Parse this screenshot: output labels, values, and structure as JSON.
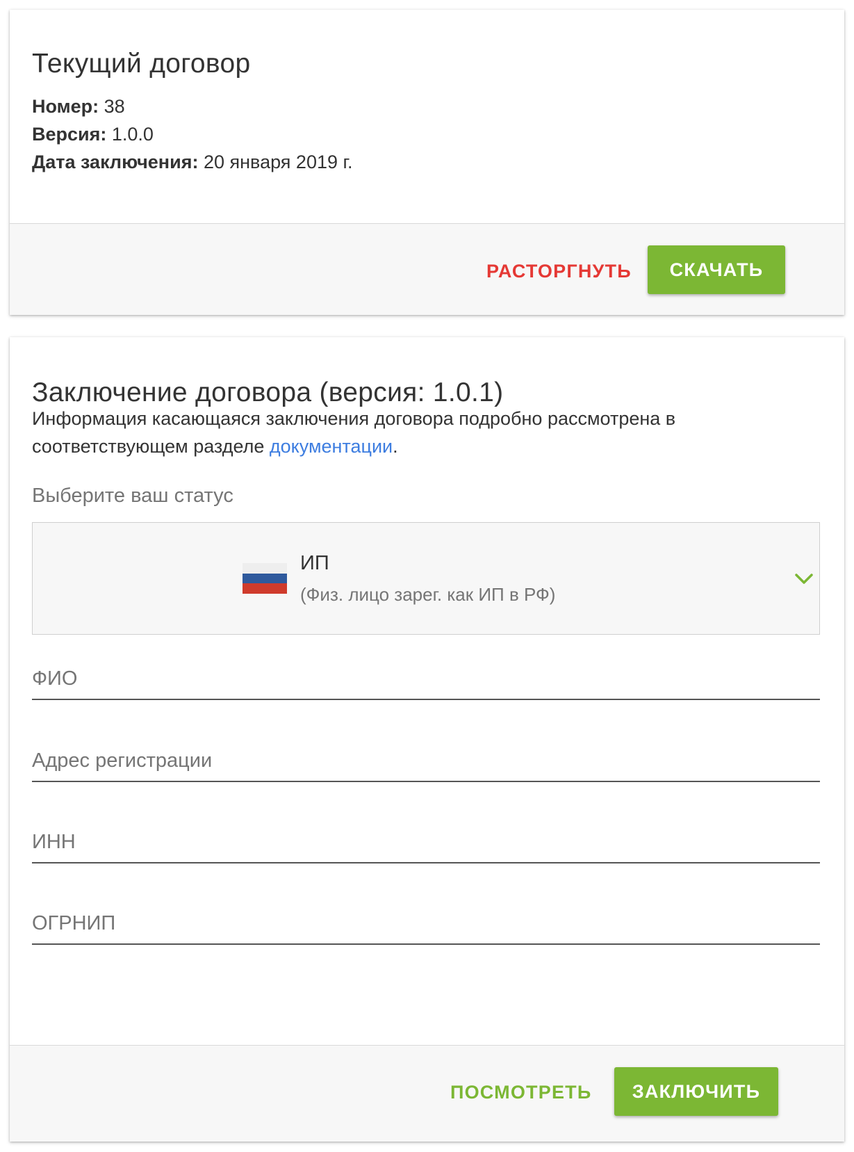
{
  "current_contract": {
    "title": "Текущий договор",
    "number_label": "Номер:",
    "number_value": "38",
    "version_label": "Версия:",
    "version_value": "1.0.0",
    "date_label": "Дата заключения:",
    "date_value": "20 января 2019 г.",
    "terminate_button": "РАСТОРГНУТЬ",
    "download_button": "СКАЧАТЬ"
  },
  "new_contract": {
    "title": "Заключение договора (версия: 1.0.1)",
    "description_text": "Информация касающаяся заключения договора подробно рассмотрена в соответствующем разделе ",
    "description_link": "документации",
    "description_end": ".",
    "status_label": "Выберите ваш статус",
    "status_select": {
      "title": "ИП",
      "subtitle": "(Физ. лицо зарег. как ИП в РФ)",
      "flag_icon": "russia-flag-icon",
      "chevron_icon": "chevron-down-icon"
    },
    "fields": {
      "fio_placeholder": "ФИО",
      "address_placeholder": "Адрес регистрации",
      "inn_placeholder": "ИНН",
      "ogrnip_placeholder": "ОГРНИП"
    },
    "preview_button": "ПОСМОТРЕТЬ",
    "conclude_button": "ЗАКЛЮЧИТЬ"
  },
  "colors": {
    "accent_green": "#7cb734",
    "danger_red": "#e53935",
    "link_blue": "#3d7de0"
  }
}
